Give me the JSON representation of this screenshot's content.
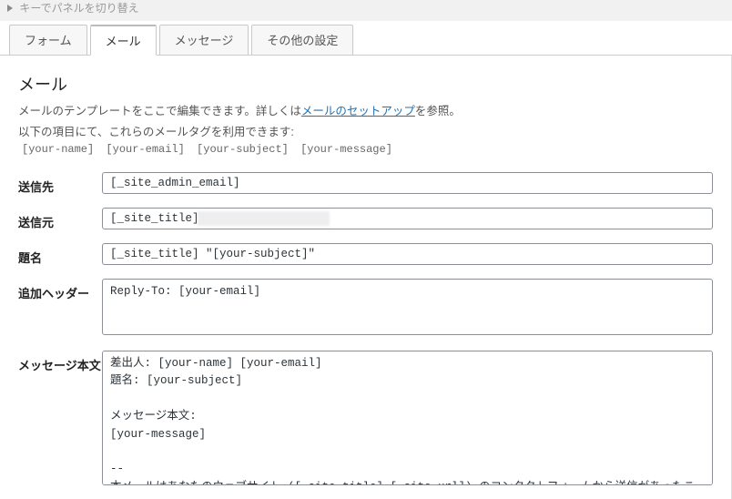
{
  "toggleLabel": "キーでパネルを切り替え",
  "tabs": {
    "form": "フォーム",
    "mail": "メール",
    "messages": "メッセージ",
    "other": "その他の設定"
  },
  "section": {
    "title": "メール",
    "desc1_pre": "メールのテンプレートをここで編集できます。詳しくは",
    "desc1_link": "メールのセットアップ",
    "desc1_post": "を参照。",
    "desc2": "以下の項目にて、これらのメールタグを利用できます:"
  },
  "mailtags": [
    "[your-name]",
    "[your-email]",
    "[your-subject]",
    "[your-message]"
  ],
  "fields": {
    "to": {
      "label": "送信先",
      "value": "[_site_admin_email]"
    },
    "from": {
      "label": "送信元",
      "value": "[_site_title] "
    },
    "subject": {
      "label": "題名",
      "value": "[_site_title] \"[your-subject]\""
    },
    "headers": {
      "label": "追加ヘッダー",
      "value": "Reply-To: [your-email]"
    },
    "body": {
      "label": "メッセージ本文",
      "value": "差出人: [your-name] [your-email]\n題名: [your-subject]\n\nメッセージ本文:\n[your-message]\n\n-- \n本メールはあなたのウェブサイト ([_site_title] [_site_url]) のコンタクトフォームから送信があったことをお知らせするものです。"
    }
  }
}
